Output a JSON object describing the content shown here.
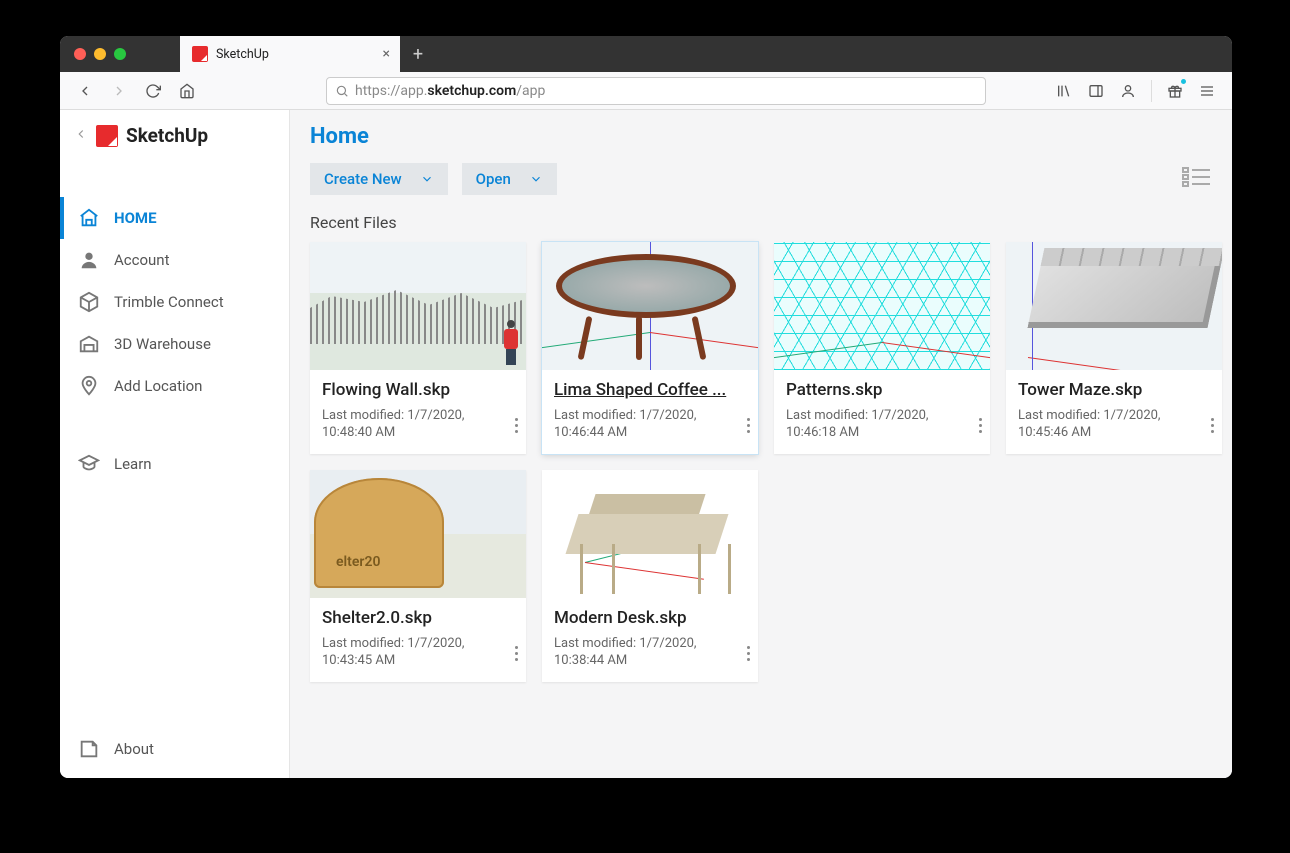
{
  "browser": {
    "tab_title": "SketchUp",
    "url_plain_pre": "https://app.",
    "url_bold": "sketchup.com",
    "url_plain_post": "/app"
  },
  "brand": {
    "name": "SketchUp"
  },
  "nav": {
    "home": "HOME",
    "account": "Account",
    "trimble": "Trimble Connect",
    "warehouse": "3D Warehouse",
    "location": "Add Location",
    "learn": "Learn",
    "about": "About"
  },
  "page": {
    "title": "Home",
    "create": "Create New",
    "open": "Open",
    "recent": "Recent Files"
  },
  "files": [
    {
      "name": "Flowing Wall.skp",
      "modified": "Last modified: 1/7/2020, 10:48:40 AM"
    },
    {
      "name": "Lima Shaped Coffee ...",
      "modified": "Last modified: 1/7/2020, 10:46:44 AM"
    },
    {
      "name": "Patterns.skp",
      "modified": "Last modified: 1/7/2020, 10:46:18 AM"
    },
    {
      "name": "Tower Maze.skp",
      "modified": "Last modified: 1/7/2020, 10:45:46 AM"
    },
    {
      "name": "Shelter2.0.skp",
      "modified": "Last modified: 1/7/2020, 10:43:45 AM"
    },
    {
      "name": "Modern Desk.skp",
      "modified": "Last modified: 1/7/2020, 10:38:44 AM"
    }
  ]
}
